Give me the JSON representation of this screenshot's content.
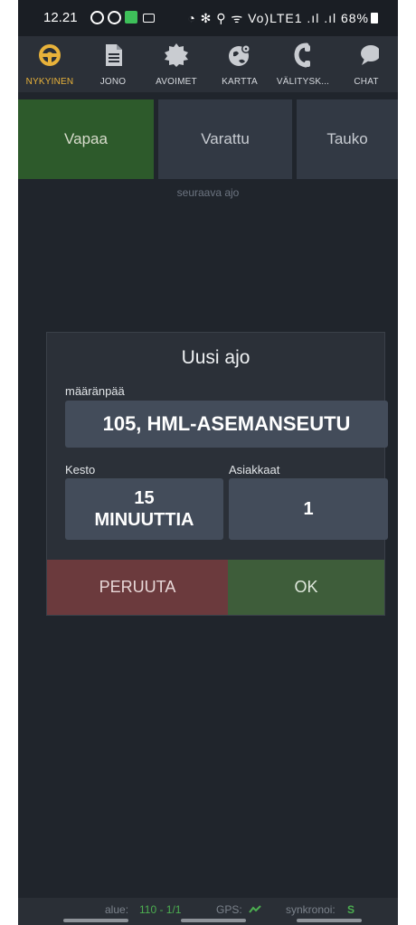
{
  "status_bar": {
    "time": "12.21",
    "right": "◔ ✻ ⚲ ᯤ Vo)LTE1 .ıl .ıl 68%"
  },
  "tabs": [
    {
      "label": "NYKYINEN",
      "icon": "steering-wheel",
      "active": true
    },
    {
      "label": "JONO",
      "icon": "document",
      "active": false
    },
    {
      "label": "AVOIMET",
      "icon": "badge",
      "active": false
    },
    {
      "label": "KARTTA",
      "icon": "globe-pin",
      "active": false
    },
    {
      "label": "VÄLITYSK...",
      "icon": "headset",
      "active": false
    },
    {
      "label": "CHAT",
      "icon": "chat-bubble",
      "active": false
    }
  ],
  "status_buttons": {
    "free": "Vapaa",
    "busy": "Varattu",
    "break": "Tauko"
  },
  "next_ride": "seuraava ajo",
  "dialog": {
    "title": "Uusi ajo",
    "destination_label": "määränpää",
    "destination": "105, HML-ASEMANSEUTU",
    "duration_label": "Kesto",
    "duration_value": "15",
    "duration_unit": "MINUUTTIA",
    "customers_label": "Asiakkaat",
    "customers": "1",
    "cancel": "PERUUTA",
    "ok": "OK"
  },
  "bottom": {
    "area_label": "alue:",
    "area_value": "110 - 1/1",
    "gps_label": "GPS:",
    "sync_label": "synkronoi:",
    "sync_value": "S"
  },
  "colors": {
    "active_tab": "#e8b23a",
    "free": "#2d5a2b",
    "ok": "#3e5d3a",
    "cancel": "#6b3a3d",
    "good": "#4caf50"
  }
}
